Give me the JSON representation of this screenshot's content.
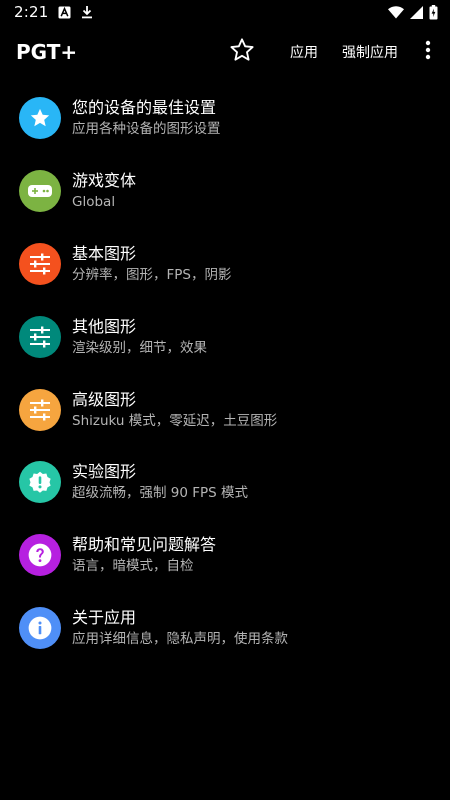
{
  "status_bar": {
    "time": "2:21",
    "icons": [
      "a-icon",
      "download-icon",
      "wifi-icon",
      "signal-icon",
      "battery-icon"
    ]
  },
  "app_bar": {
    "title": "PGT+",
    "star_icon": "star-outline-icon",
    "apply_label": "应用",
    "force_apply_label": "强制应用",
    "overflow_icon": "more-vert-icon"
  },
  "menu": {
    "items": [
      {
        "title": "您的设备的最佳设置",
        "subtitle": "应用各种设备的图形设置",
        "icon": "star-icon",
        "color": "#29b6f6"
      },
      {
        "title": "游戏变体",
        "subtitle": "Global",
        "icon": "gamepad-icon",
        "color": "#7cb342"
      },
      {
        "title": "基本图形",
        "subtitle": "分辨率，图形，FPS，阴影",
        "icon": "tune-icon",
        "color": "#f4511e"
      },
      {
        "title": "其他图形",
        "subtitle": "渲染级别，细节，效果",
        "icon": "tune-icon",
        "color": "#00897b"
      },
      {
        "title": "高级图形",
        "subtitle": "Shizuku 模式，零延迟，土豆图形",
        "icon": "tune-icon",
        "color": "#f6a53f"
      },
      {
        "title": "实验图形",
        "subtitle": "超级流畅，强制 90 FPS 模式",
        "icon": "badge-alert-icon",
        "color": "#26c6a6"
      },
      {
        "title": "帮助和常见问题解答",
        "subtitle": "语言，暗模式，自检",
        "icon": "help-icon",
        "color": "#b620e0"
      },
      {
        "title": "关于应用",
        "subtitle": "应用详细信息，隐私声明，使用条款",
        "icon": "info-icon",
        "color": "#4f8ff7"
      }
    ]
  }
}
